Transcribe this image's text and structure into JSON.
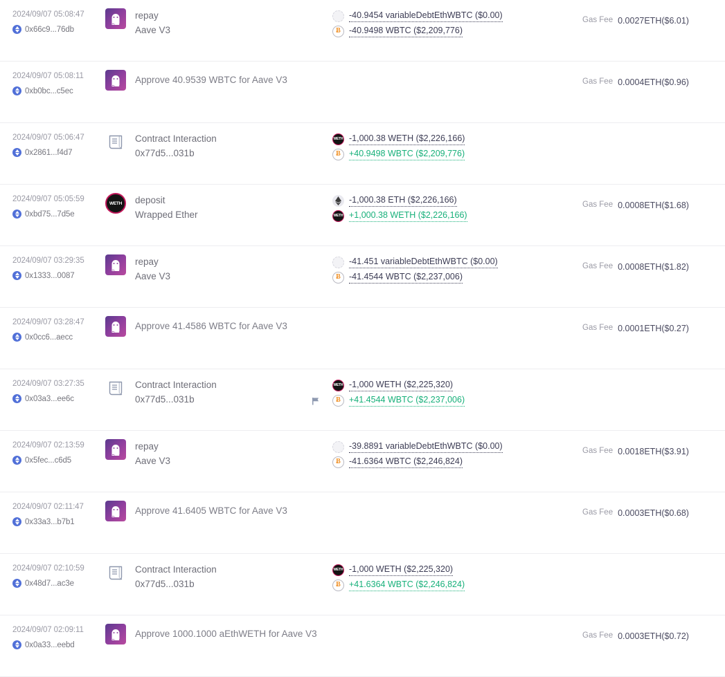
{
  "labels": {
    "gas_fee": "Gas Fee"
  },
  "colors": {
    "positive": "#17b07a",
    "negative": "#3d3d55",
    "muted": "#9a9aa5",
    "eth_badge": "#5170d8",
    "aave_gradient_start": "#5b3a8e",
    "aave_gradient_end": "#b84a9e",
    "wbtc_orange": "#f0932b",
    "weth_ring": "#c2185b",
    "flag": "#8f9bb3",
    "row_divider": "#ededf0"
  },
  "transactions": [
    {
      "time": "2024/09/07 05:08:47",
      "hash": "0x66c9...76db",
      "icon": "aave-icon",
      "title": "repay",
      "subtitle": "Aave V3",
      "transfers": [
        {
          "icon": "variable-debt-token-icon",
          "text": "-40.9454 variableDebtEthWBTC ($0.00)",
          "sign": "neg",
          "flag": false
        },
        {
          "icon": "wbtc-token-icon",
          "text": "-40.9498 WBTC ($2,209,776)",
          "sign": "neg",
          "flag": false
        }
      ],
      "gas_fee": "0.0027ETH($6.01)"
    },
    {
      "time": "2024/09/07 05:08:11",
      "hash": "0xb0bc...c5ec",
      "icon": "aave-icon",
      "title": "Approve 40.9539 WBTC for Aave V3",
      "subtitle": "",
      "transfers": [],
      "gas_fee": "0.0004ETH($0.96)"
    },
    {
      "time": "2024/09/07 05:06:47",
      "hash": "0x2861...f4d7",
      "icon": "contract-icon",
      "title": "Contract Interaction",
      "subtitle": "0x77d5...031b",
      "transfers": [
        {
          "icon": "weth-token-icon",
          "text": "-1,000.38 WETH ($2,226,166)",
          "sign": "neg",
          "flag": false
        },
        {
          "icon": "wbtc-token-icon",
          "text": "+40.9498 WBTC ($2,209,776)",
          "sign": "pos",
          "flag": false
        }
      ],
      "gas_fee": ""
    },
    {
      "time": "2024/09/07 05:05:59",
      "hash": "0xbd75...7d5e",
      "icon": "weth-app-icon",
      "title": "deposit",
      "subtitle": "Wrapped Ether",
      "transfers": [
        {
          "icon": "eth-token-icon",
          "text": "-1,000.38 ETH ($2,226,166)",
          "sign": "neg",
          "flag": false
        },
        {
          "icon": "weth-token-icon",
          "text": "+1,000.38 WETH ($2,226,166)",
          "sign": "pos",
          "flag": false
        }
      ],
      "gas_fee": "0.0008ETH($1.68)"
    },
    {
      "time": "2024/09/07 03:29:35",
      "hash": "0x1333...0087",
      "icon": "aave-icon",
      "title": "repay",
      "subtitle": "Aave V3",
      "transfers": [
        {
          "icon": "variable-debt-token-icon",
          "text": "-41.451 variableDebtEthWBTC ($0.00)",
          "sign": "neg",
          "flag": false
        },
        {
          "icon": "wbtc-token-icon",
          "text": "-41.4544 WBTC ($2,237,006)",
          "sign": "neg",
          "flag": false
        }
      ],
      "gas_fee": "0.0008ETH($1.82)"
    },
    {
      "time": "2024/09/07 03:28:47",
      "hash": "0x0cc6...aecc",
      "icon": "aave-icon",
      "title": "Approve 41.4586 WBTC for Aave V3",
      "subtitle": "",
      "transfers": [],
      "gas_fee": "0.0001ETH($0.27)"
    },
    {
      "time": "2024/09/07 03:27:35",
      "hash": "0x03a3...ee6c",
      "icon": "contract-icon",
      "title": "Contract Interaction",
      "subtitle": "0x77d5...031b",
      "transfers": [
        {
          "icon": "weth-token-icon",
          "text": "-1,000 WETH ($2,225,320)",
          "sign": "neg",
          "flag": false
        },
        {
          "icon": "wbtc-token-icon",
          "text": "+41.4544 WBTC ($2,237,006)",
          "sign": "pos",
          "flag": true
        }
      ],
      "gas_fee": ""
    },
    {
      "time": "2024/09/07 02:13:59",
      "hash": "0x5fec...c6d5",
      "icon": "aave-icon",
      "title": "repay",
      "subtitle": "Aave V3",
      "transfers": [
        {
          "icon": "variable-debt-token-icon",
          "text": "-39.8891 variableDebtEthWBTC ($0.00)",
          "sign": "neg",
          "flag": false
        },
        {
          "icon": "wbtc-token-icon",
          "text": "-41.6364 WBTC ($2,246,824)",
          "sign": "neg",
          "flag": false
        }
      ],
      "gas_fee": "0.0018ETH($3.91)"
    },
    {
      "time": "2024/09/07 02:11:47",
      "hash": "0x33a3...b7b1",
      "icon": "aave-icon",
      "title": "Approve 41.6405 WBTC for Aave V3",
      "subtitle": "",
      "transfers": [],
      "gas_fee": "0.0003ETH($0.68)"
    },
    {
      "time": "2024/09/07 02:10:59",
      "hash": "0x48d7...ac3e",
      "icon": "contract-icon",
      "title": "Contract Interaction",
      "subtitle": "0x77d5...031b",
      "transfers": [
        {
          "icon": "weth-token-icon",
          "text": "-1,000 WETH ($2,225,320)",
          "sign": "neg",
          "flag": false
        },
        {
          "icon": "wbtc-token-icon",
          "text": "+41.6364 WBTC ($2,246,824)",
          "sign": "pos",
          "flag": false
        }
      ],
      "gas_fee": ""
    },
    {
      "time": "2024/09/07 02:09:11",
      "hash": "0x0a33...eebd",
      "icon": "aave-icon",
      "title": "Approve 1000.1000 aEthWETH for Aave V3",
      "subtitle": "",
      "transfers": [],
      "gas_fee": "0.0003ETH($0.72)"
    }
  ]
}
